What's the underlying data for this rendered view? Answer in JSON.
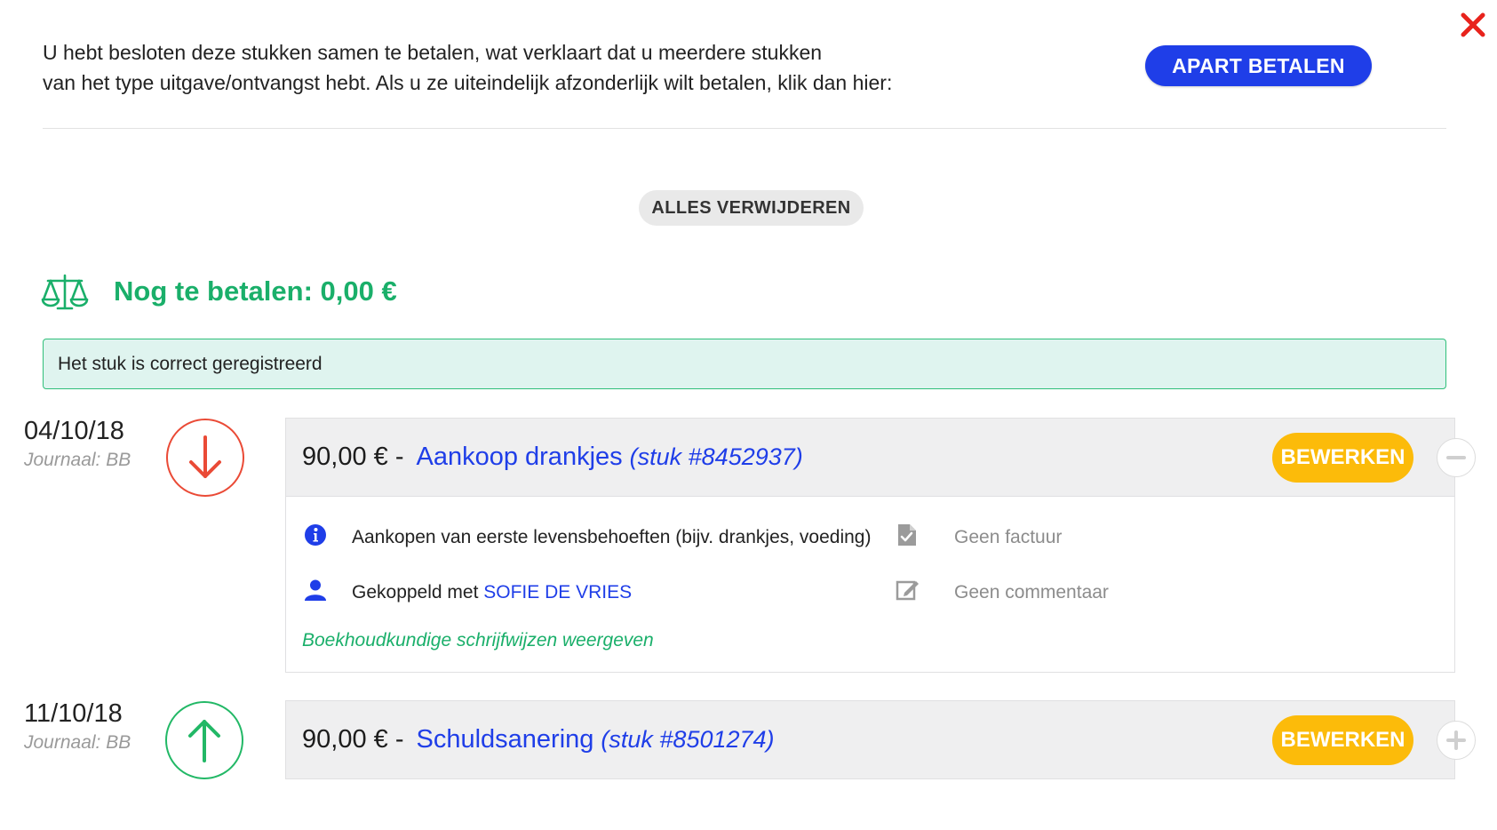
{
  "header": {
    "info_line1": "U hebt besloten deze stukken samen te betalen, wat verklaart dat u meerdere stukken",
    "info_line2": "van het type uitgave/ontvangst hebt. Als u ze uiteindelijk afzonderlijk wilt betalen, klik dan hier:",
    "apart_button": "APART BETALEN",
    "close_icon": "close-icon"
  },
  "actions": {
    "remove_all": "ALLES VERWIJDEREN"
  },
  "balance": {
    "icon": "scale-icon",
    "label": "Nog te betalen: 0,00 €"
  },
  "status": {
    "message": "Het stuk is correct geregistreerd"
  },
  "entries": [
    {
      "date": "04/10/18",
      "journal": "Journaal: BB",
      "direction": "down",
      "amount": "90,00 € -",
      "title": "Aankoop drankjes",
      "stuk": "(stuk #8452937)",
      "edit_label": "BEWERKEN",
      "expanded": true,
      "details": {
        "category": "Aankopen van eerste levensbehoeften (bijv. drankjes, voeding)",
        "linked_prefix": "Gekoppeld met",
        "linked_person": "SOFIE DE VRIES",
        "invoice": "Geen factuur",
        "comment": "Geen commentaar",
        "accounting_link": "Boekhoudkundige schrijfwijzen weergeven"
      }
    },
    {
      "date": "11/10/18",
      "journal": "Journaal: BB",
      "direction": "up",
      "amount": "90,00 € -",
      "title": "Schuldsanering",
      "stuk": "(stuk #8501274)",
      "edit_label": "BEWERKEN",
      "expanded": false
    }
  ],
  "colors": {
    "primary_blue": "#1f3ee8",
    "success_green": "#1aaf6a",
    "warning_yellow": "#fcbb0a",
    "expense_red": "#ea4a36",
    "close_red": "#e8231c"
  }
}
